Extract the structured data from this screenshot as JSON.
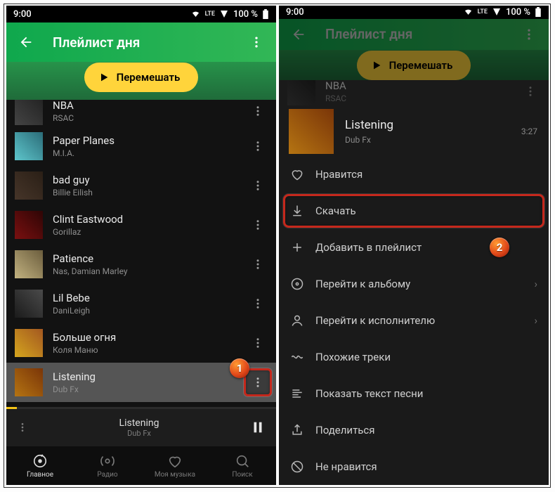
{
  "statusbar": {
    "time": "9:00",
    "net": "LTE",
    "battery": "100 %"
  },
  "header": {
    "title": "Плейлист дня"
  },
  "shuffle": {
    "label": "Перемешать"
  },
  "tracks": [
    {
      "title": "NBA",
      "artist": "RSAC"
    },
    {
      "title": "Paper Planes",
      "artist": "M.I.A."
    },
    {
      "title": "bad guy",
      "artist": "Billie Eilish"
    },
    {
      "title": "Clint Eastwood",
      "artist": "Gorillaz"
    },
    {
      "title": "Patience",
      "artist": "Nas, Damian Marley"
    },
    {
      "title": "Lil Bebe",
      "artist": "DaniLeigh"
    },
    {
      "title": "Больше огня",
      "artist": "Коля Маню"
    },
    {
      "title": "Listening",
      "artist": "Dub Fx"
    }
  ],
  "nowplaying": {
    "title": "Listening",
    "artist": "Dub Fx"
  },
  "nav": {
    "home": "Главное",
    "radio": "Радио",
    "mymusic": "Моя музыка",
    "search": "Поиск"
  },
  "context": {
    "track": {
      "title": "Listening",
      "artist": "Dub Fx",
      "duration": "3:27"
    },
    "menu": {
      "like": "Нравится",
      "download": "Скачать",
      "add": "Добавить в плейлист",
      "album": "Перейти к альбому",
      "artist": "Перейти к исполнителю",
      "similar": "Похожие треки",
      "lyrics": "Показать текст песни",
      "share": "Поделиться",
      "dislike": "Не нравится"
    }
  },
  "annotations": {
    "a1": "1",
    "a2": "2"
  }
}
